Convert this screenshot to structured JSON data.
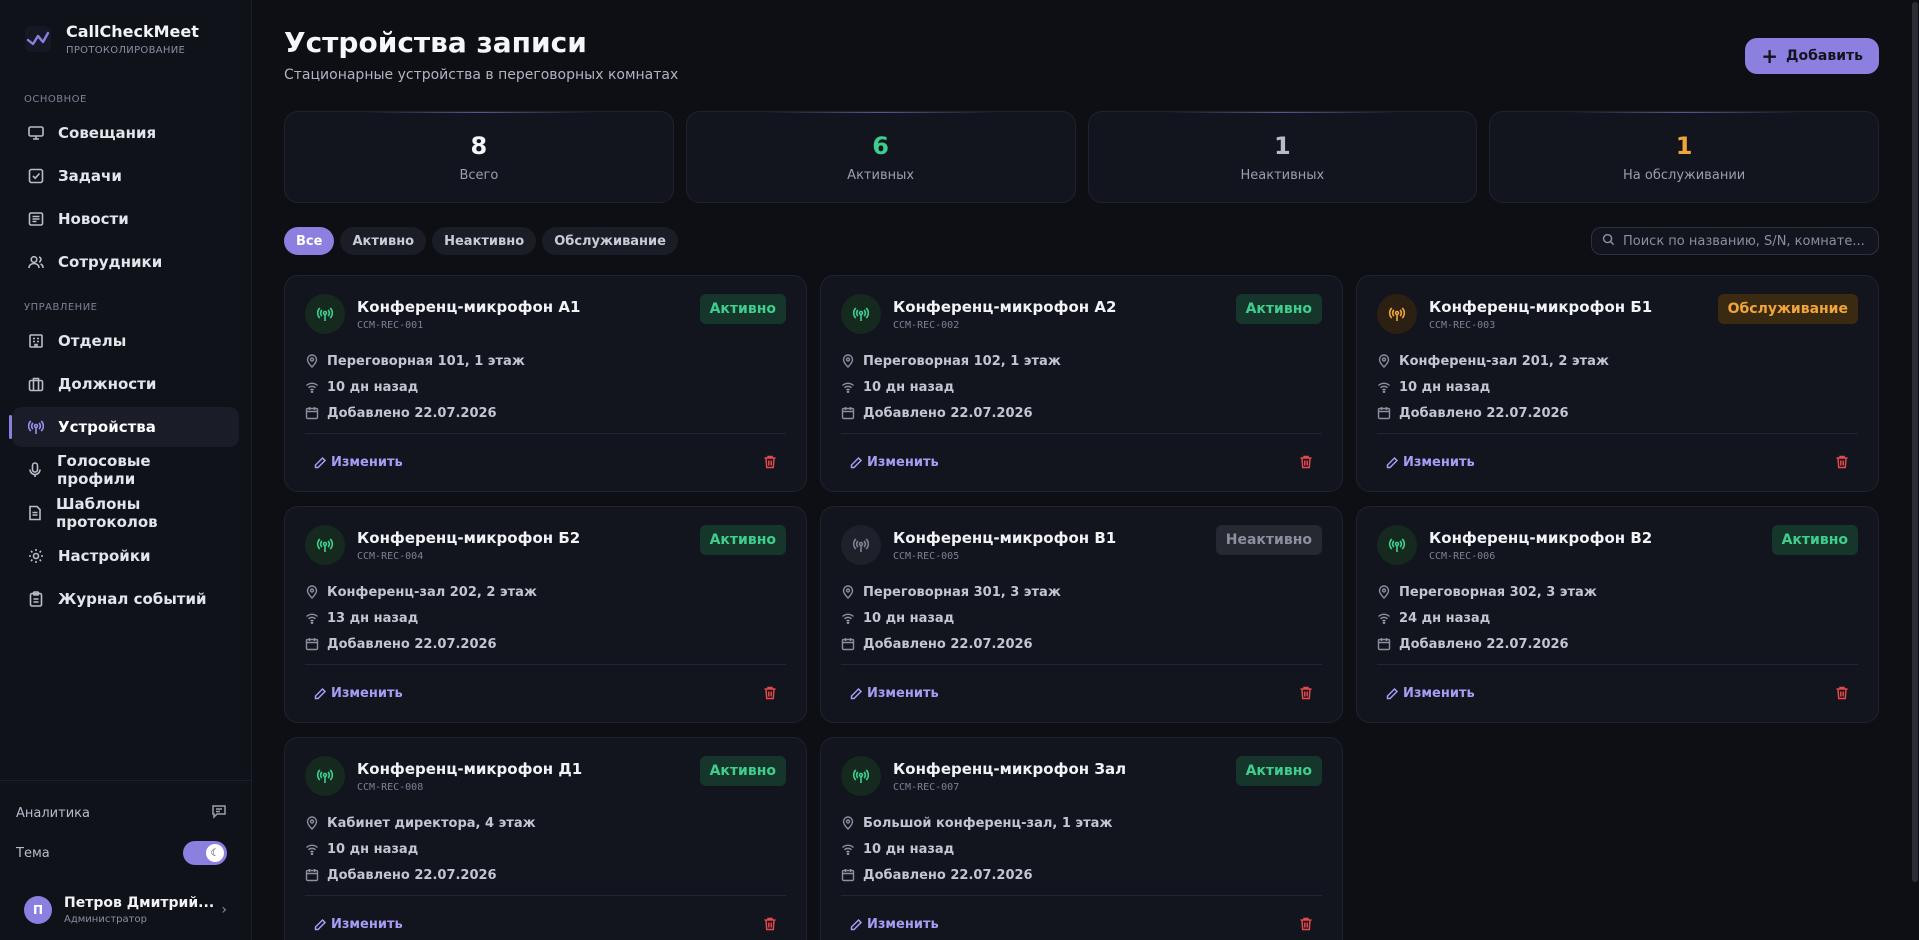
{
  "brand": {
    "name": "CallCheckMeet",
    "subtitle": "ПРОТОКОЛИРОВАНИЕ"
  },
  "sidebar": {
    "section_main": "ОСНОВНОЕ",
    "section_manage": "УПРАВЛЕНИЕ",
    "main_items": [
      {
        "label": "Совещания",
        "icon": "monitor-icon"
      },
      {
        "label": "Задачи",
        "icon": "checkbox-icon"
      },
      {
        "label": "Новости",
        "icon": "newspaper-icon"
      },
      {
        "label": "Сотрудники",
        "icon": "users-icon"
      }
    ],
    "manage_items": [
      {
        "label": "Отделы",
        "icon": "building-icon"
      },
      {
        "label": "Должности",
        "icon": "briefcase-icon"
      },
      {
        "label": "Устройства",
        "icon": "antenna-icon",
        "active": true
      },
      {
        "label": "Голосовые профили",
        "icon": "mic-icon"
      },
      {
        "label": "Шаблоны протоколов",
        "icon": "document-icon"
      },
      {
        "label": "Настройки",
        "icon": "gear-icon"
      },
      {
        "label": "Журнал событий",
        "icon": "clipboard-icon"
      }
    ],
    "analytics_label": "Аналитика",
    "theme_label": "Тема",
    "user": {
      "initial": "П",
      "name": "Петров Дмитрий...",
      "role": "Администратор"
    }
  },
  "header": {
    "title": "Устройства записи",
    "subtitle": "Стационарные устройства в переговорных комнатах",
    "add_label": "Добавить"
  },
  "stats": [
    {
      "value": "8",
      "label": "Всего",
      "color": "#f5f6fa"
    },
    {
      "value": "6",
      "label": "Активных",
      "color": "#3ecf8e"
    },
    {
      "value": "1",
      "label": "Неактивных",
      "color": "#b8bcc9"
    },
    {
      "value": "1",
      "label": "На обслуживании",
      "color": "#f0a53a"
    }
  ],
  "filters": {
    "chips": [
      "Все",
      "Активно",
      "Неактивно",
      "Обслуживание"
    ],
    "active": "Все",
    "search_placeholder": "Поиск по названию, S/N, комнате..."
  },
  "card_labels": {
    "edit": "Изменить"
  },
  "devices": [
    {
      "name": "Конференц-микрофон А1",
      "sn": "CCM-REC-001",
      "status": "Активно",
      "kind": "ok",
      "room": "Переговорная 101, 1 этаж",
      "seen": "10 дн назад",
      "added": "Добавлено 22.07.2026"
    },
    {
      "name": "Конференц-микрофон А2",
      "sn": "CCM-REC-002",
      "status": "Активно",
      "kind": "ok",
      "room": "Переговорная 102, 1 этаж",
      "seen": "10 дн назад",
      "added": "Добавлено 22.07.2026"
    },
    {
      "name": "Конференц-микрофон Б1",
      "sn": "CCM-REC-003",
      "status": "Обслуживание",
      "kind": "maint",
      "room": "Конференц-зал 201, 2 этаж",
      "seen": "10 дн назад",
      "added": "Добавлено 22.07.2026"
    },
    {
      "name": "Конференц-микрофон Б2",
      "sn": "CCM-REC-004",
      "status": "Активно",
      "kind": "ok",
      "room": "Конференц-зал 202, 2 этаж",
      "seen": "13 дн назад",
      "added": "Добавлено 22.07.2026"
    },
    {
      "name": "Конференц-микрофон В1",
      "sn": "CCM-REC-005",
      "status": "Неактивно",
      "kind": "off",
      "room": "Переговорная 301, 3 этаж",
      "seen": "10 дн назад",
      "added": "Добавлено 22.07.2026"
    },
    {
      "name": "Конференц-микрофон В2",
      "sn": "CCM-REC-006",
      "status": "Активно",
      "kind": "ok",
      "room": "Переговорная 302, 3 этаж",
      "seen": "24 дн назад",
      "added": "Добавлено 22.07.2026"
    },
    {
      "name": "Конференц-микрофон Д1",
      "sn": "CCM-REC-008",
      "status": "Активно",
      "kind": "ok",
      "room": "Кабинет директора, 4 этаж",
      "seen": "10 дн назад",
      "added": "Добавлено 22.07.2026"
    },
    {
      "name": "Конференц-микрофон Зал",
      "sn": "CCM-REC-007",
      "status": "Активно",
      "kind": "ok",
      "room": "Большой конференц-зал, 1 этаж",
      "seen": "10 дн назад",
      "added": "Добавлено 22.07.2026"
    }
  ]
}
